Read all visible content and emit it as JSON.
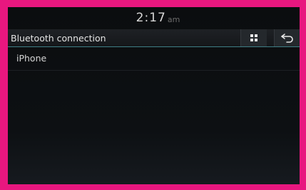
{
  "status": {
    "time": "2:17",
    "ampm": "am"
  },
  "header": {
    "title": "Bluetooth connection",
    "grid_icon": "grid-menu-icon",
    "back_icon": "back-arrow-icon"
  },
  "devices": [
    {
      "label": "iPhone"
    }
  ],
  "colors": {
    "frame": "#e8177f",
    "screen": "#0b0d0f",
    "accent_line": "#3f7f86"
  }
}
